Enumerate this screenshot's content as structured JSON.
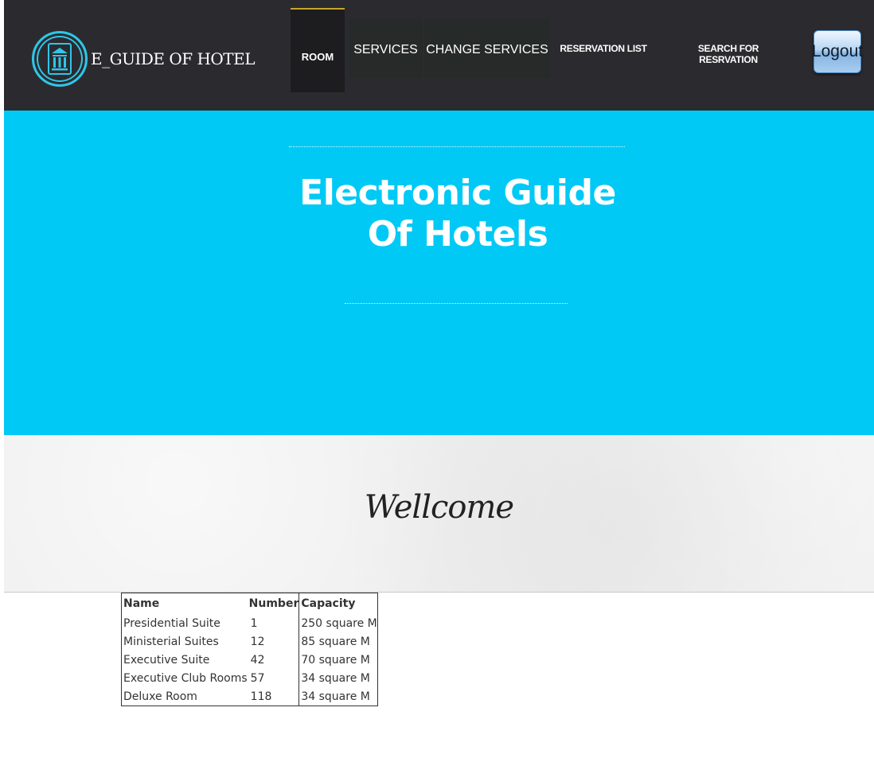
{
  "navbar": {
    "brand": "E_GUIDE OF HOTEL",
    "items": {
      "room": "ROOM",
      "services": "SERVICES",
      "change_services": "CHANGE SERVICES",
      "reservation_list": "RESERVATION LIST",
      "search_reservation": "SEARCH FOR RESRVATION"
    },
    "logout": "Logout"
  },
  "hero": {
    "title_line1": "Electronic Guide",
    "title_line2": "Of Hotels"
  },
  "welcome": {
    "text": "Wellcome"
  },
  "rooms_table": {
    "headers": [
      "Name",
      "Number",
      "Capacity"
    ],
    "rows": [
      [
        "Presidential Suite",
        "1",
        "250 square M"
      ],
      [
        "Ministerial Suites",
        "12",
        "85 square M"
      ],
      [
        "Executive Suite",
        "42",
        "70 square M"
      ],
      [
        "Executive Club Rooms",
        "57",
        "34 square M"
      ],
      [
        "Deluxe Room",
        "118",
        "34 square M"
      ]
    ]
  },
  "colors": {
    "navbar_bg": "#2b2b2f",
    "hero_bg": "#00c9f5",
    "logo_accent": "#2fc6e8",
    "active_tab_border": "#c8a52c"
  },
  "icons": {
    "brand_logo": "hotel-building-icon"
  }
}
